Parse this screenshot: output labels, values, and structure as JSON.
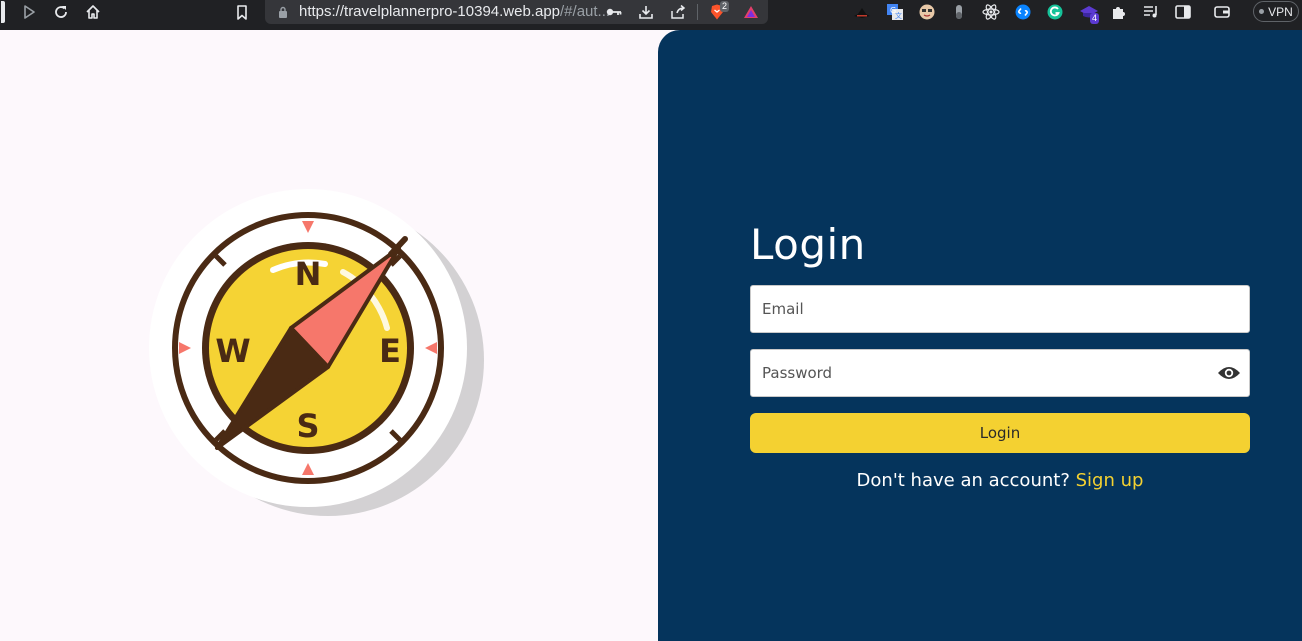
{
  "browser": {
    "url_host": "https://travelplannerpro-10394.web.app",
    "url_rest": "/#/aut...",
    "vpn_label": "VPN",
    "brave_badge": "2",
    "ext_badge": "4",
    "icons": [
      "play-icon",
      "reload-icon",
      "home-icon",
      "bookmark-icon",
      "lock-icon",
      "key-icon",
      "download-icon",
      "share-icon",
      "brave-shield-icon",
      "brave-rewards-icon",
      "extensions-icon",
      "media-icon",
      "sidebar-icon",
      "wallet-icon"
    ]
  },
  "illustration": {
    "compass_letters": {
      "north": "N",
      "south": "S",
      "east": "E",
      "west": "W"
    },
    "colors": {
      "ring": "#4a2a14",
      "face": "#f5d334",
      "needle_red": "#f6776b",
      "needle_dark": "#4a2a14",
      "shadow": "#d3d1d3"
    }
  },
  "login": {
    "title": "Login",
    "email_placeholder": "Email",
    "password_placeholder": "Password",
    "button_label": "Login",
    "signup_prompt": "Don't have an account?",
    "signup_link": "Sign up",
    "colors": {
      "panel_bg": "#05345c",
      "accent": "#f4d131"
    }
  }
}
